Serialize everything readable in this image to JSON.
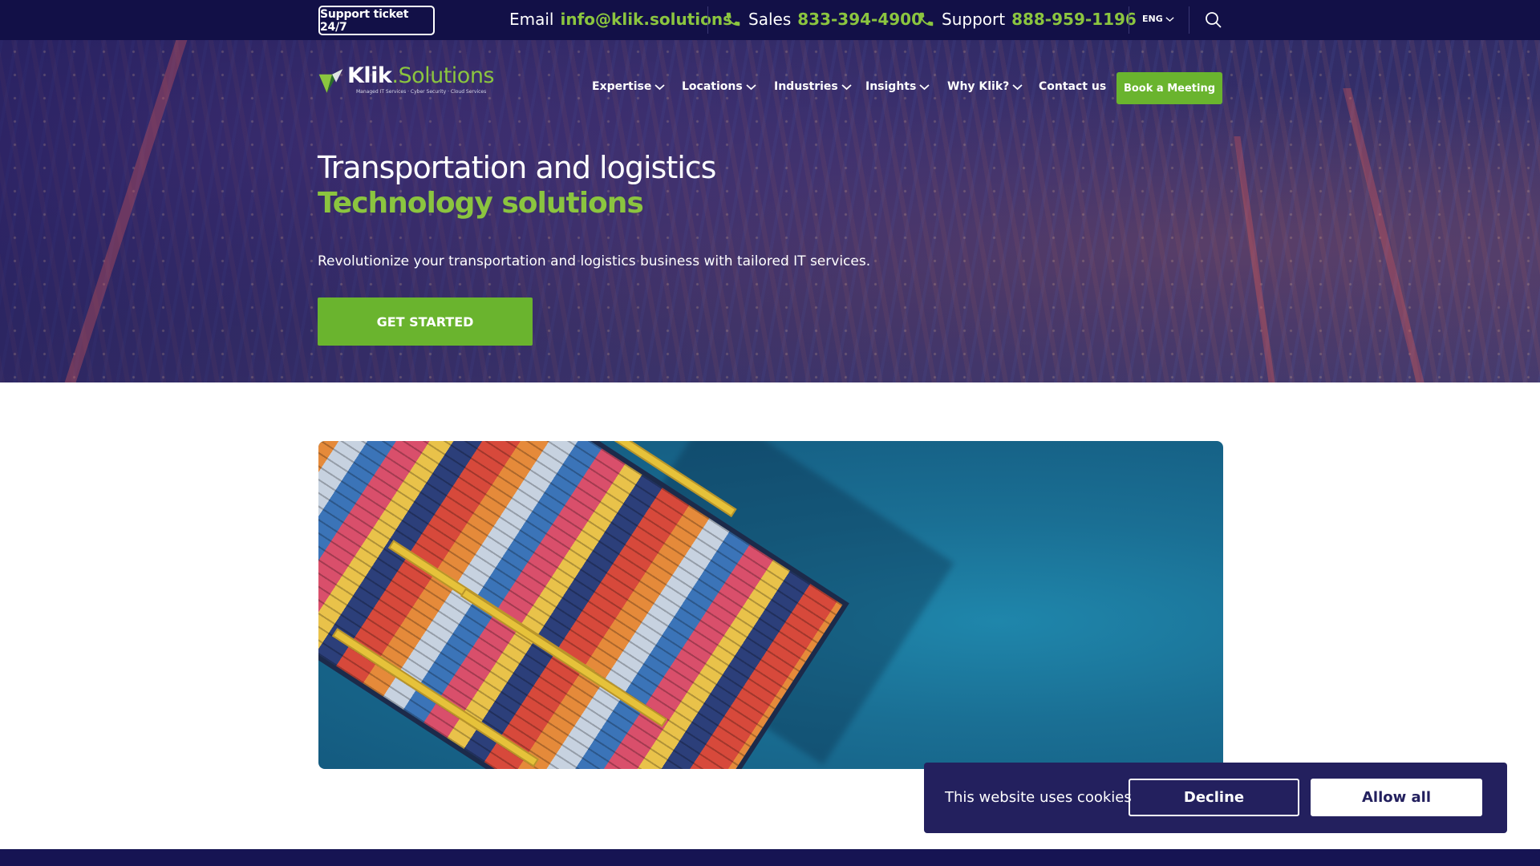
{
  "topbar": {
    "support_ticket": "Support ticket 24/7",
    "email_label": "Email",
    "email_value": "info@klik.solutions",
    "sales_label": "Sales",
    "sales_value": "833-394-4900",
    "support_label": "Support",
    "support_value": "888-959-1196",
    "language": "ENG"
  },
  "brand": {
    "name_main": "Klik",
    "name_accent": ".Solutions",
    "tagline": "Managed IT Services · Cyber Security · Cloud Services"
  },
  "nav": {
    "items": [
      "Expertise",
      "Locations",
      "Industries",
      "Insights",
      "Why Klik?",
      "Contact us"
    ],
    "book_label": "Book a Meeting"
  },
  "hero": {
    "title": "Transportation and logistics",
    "subtitle": "Technology solutions",
    "description": "Revolutionize your transportation and logistics business with tailored IT services.",
    "cta_label": "GET STARTED"
  },
  "cookie": {
    "text": "This website uses cookies",
    "decline_label": "Decline",
    "allow_label": "Allow all"
  },
  "colors": {
    "navy": "#121047",
    "accent_green": "#8bc53f",
    "button_green": "#6ab42e",
    "cookie_bg": "#23205e"
  }
}
